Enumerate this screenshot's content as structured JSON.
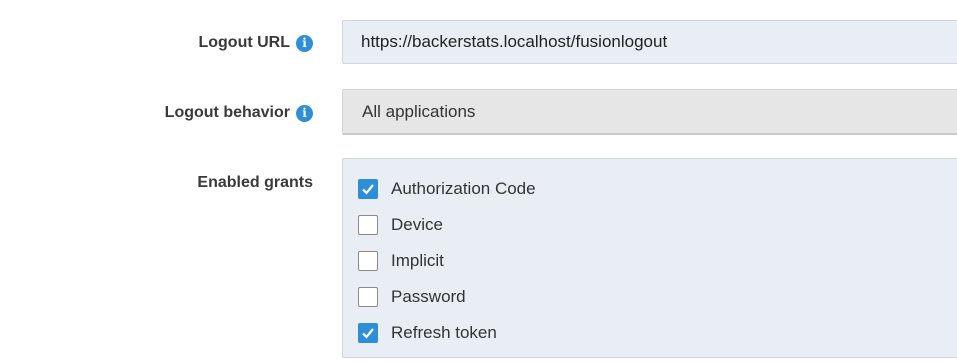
{
  "logout_url": {
    "label": "Logout URL",
    "value": "https://backerstats.localhost/fusionlogout",
    "info_icon": "info-icon"
  },
  "logout_behavior": {
    "label": "Logout behavior",
    "selected": "All applications",
    "info_icon": "info-icon"
  },
  "enabled_grants": {
    "label": "Enabled grants",
    "options": [
      {
        "label": "Authorization Code",
        "checked": true
      },
      {
        "label": "Device",
        "checked": false
      },
      {
        "label": "Implicit",
        "checked": false
      },
      {
        "label": "Password",
        "checked": false
      },
      {
        "label": "Refresh token",
        "checked": true
      }
    ]
  },
  "colors": {
    "accent": "#2f8fd6",
    "input_bg": "#e9eef5",
    "select_bg": "#e6e6e6"
  }
}
